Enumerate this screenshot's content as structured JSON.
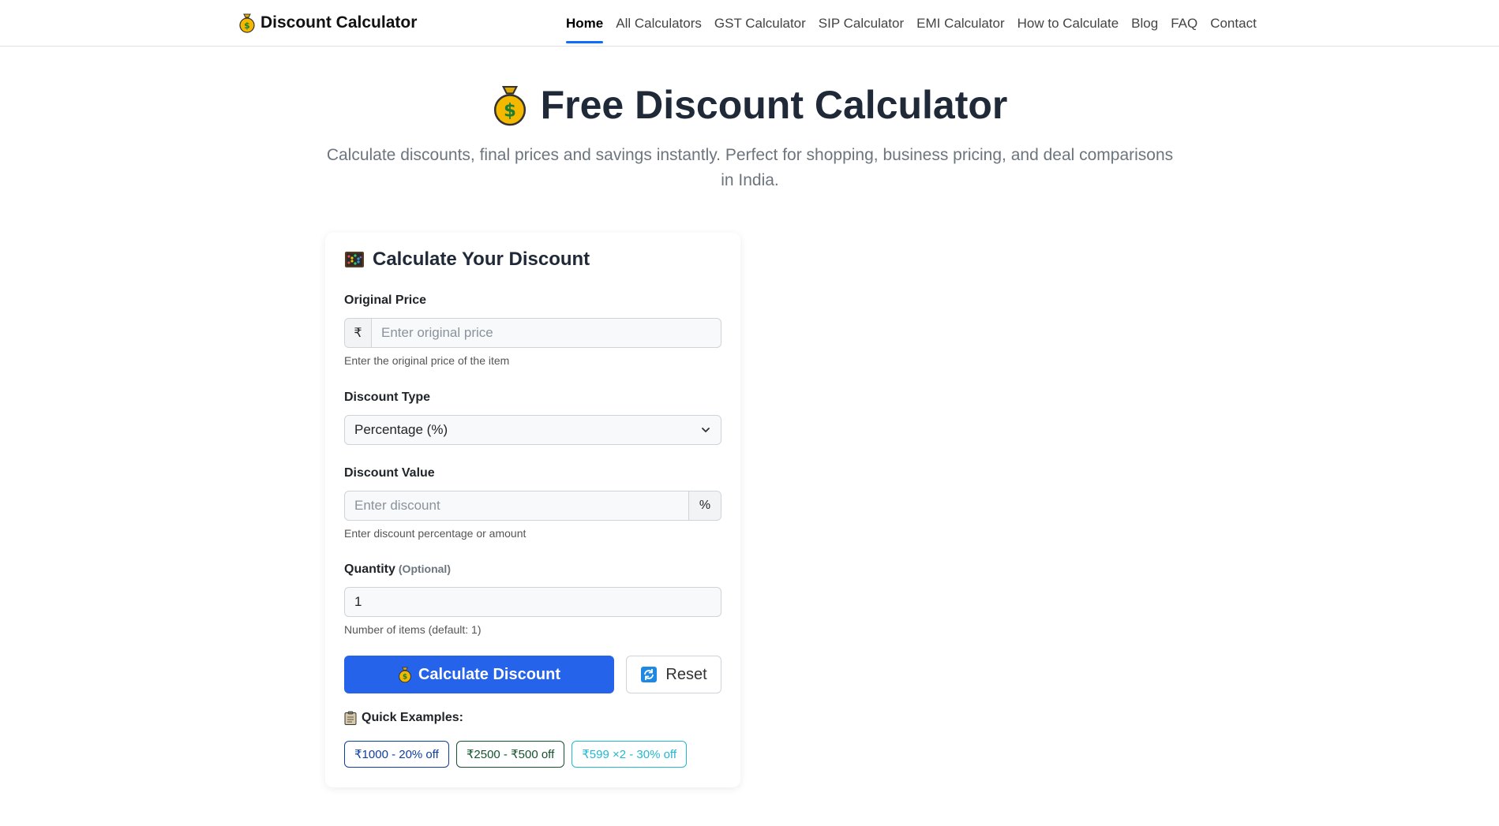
{
  "brand": {
    "name": "Discount Calculator",
    "icon": "money-bag-icon"
  },
  "nav": {
    "items": [
      {
        "label": "Home",
        "active": true
      },
      {
        "label": "All Calculators"
      },
      {
        "label": "GST Calculator"
      },
      {
        "label": "SIP Calculator"
      },
      {
        "label": "EMI Calculator"
      },
      {
        "label": "How to Calculate"
      },
      {
        "label": "Blog"
      },
      {
        "label": "FAQ"
      },
      {
        "label": "Contact"
      }
    ],
    "active_color": "#0d6efd"
  },
  "hero": {
    "title": "Free Discount Calculator",
    "subtitle": "Calculate discounts, final prices and savings instantly. Perfect for shopping, business pricing, and deal comparisons in India."
  },
  "calculator": {
    "title": "Calculate Your Discount",
    "original_price": {
      "label": "Original Price",
      "prefix": "₹",
      "placeholder": "Enter original price",
      "value": "",
      "hint": "Enter the original price of the item"
    },
    "discount_type": {
      "label": "Discount Type",
      "selected": "Percentage (%)"
    },
    "discount_value": {
      "label": "Discount Value",
      "placeholder": "Enter discount",
      "value": "",
      "suffix": "%",
      "hint": "Enter discount percentage or amount"
    },
    "quantity": {
      "label": "Quantity",
      "optional": "(Optional)",
      "value": "1",
      "hint": "Number of items (default: 1)"
    },
    "calculate_label": "Calculate Discount",
    "reset_label": "Reset",
    "quick_examples": {
      "title": "Quick Examples:",
      "items": [
        "₹1000 - 20% off",
        "₹2500 - ₹500 off",
        "₹599 ×2 - 30% off"
      ]
    },
    "primary_color": "#2563eb"
  }
}
